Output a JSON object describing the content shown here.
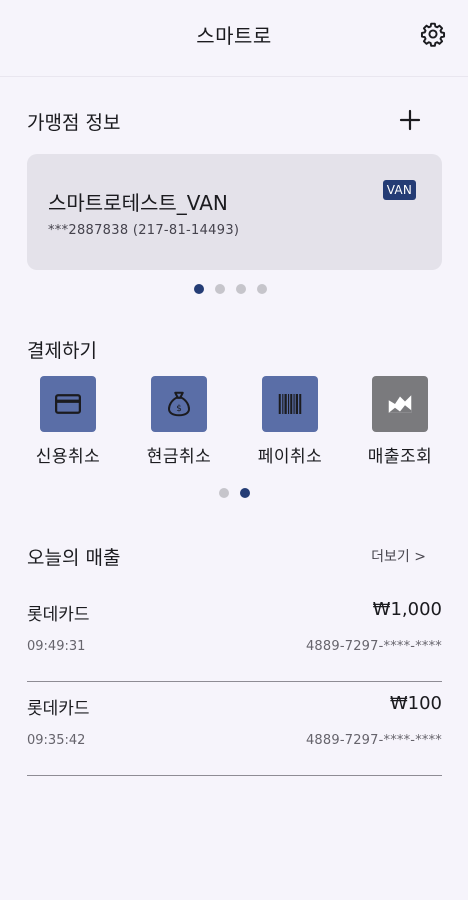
{
  "header": {
    "title": "스마트로",
    "settings_icon": "gear-icon"
  },
  "merchant_section": {
    "title": "가맹점 정보",
    "add_icon": "plus-icon",
    "card": {
      "name": "스마트로테스트_VAN",
      "sub": "***2887838 (217-81-14493)",
      "badge": "VAN"
    },
    "pager": {
      "count": 4,
      "active": 1
    }
  },
  "payment_section": {
    "title": "결제하기",
    "items": [
      {
        "label": "신용취소",
        "icon": "credit-card-icon"
      },
      {
        "label": "현금취소",
        "icon": "money-bag-icon"
      },
      {
        "label": "페이취소",
        "icon": "barcode-icon"
      },
      {
        "label": "매출조회",
        "icon": "chart-icon"
      }
    ],
    "pager": {
      "count": 2,
      "active": 2
    }
  },
  "sales_section": {
    "title": "오늘의 매출",
    "more": "더보기 >",
    "rows": [
      {
        "card": "롯데카드",
        "amount": "₩1,000",
        "time": "09:49:31",
        "card_no": "4889-7297-****-****"
      },
      {
        "card": "롯데카드",
        "amount": "₩100",
        "time": "09:35:42",
        "card_no": "4889-7297-****-****"
      }
    ]
  },
  "colors": {
    "accent": "#243c75",
    "icon_tile": "#5a6ea7",
    "background": "#f6f4fb"
  }
}
